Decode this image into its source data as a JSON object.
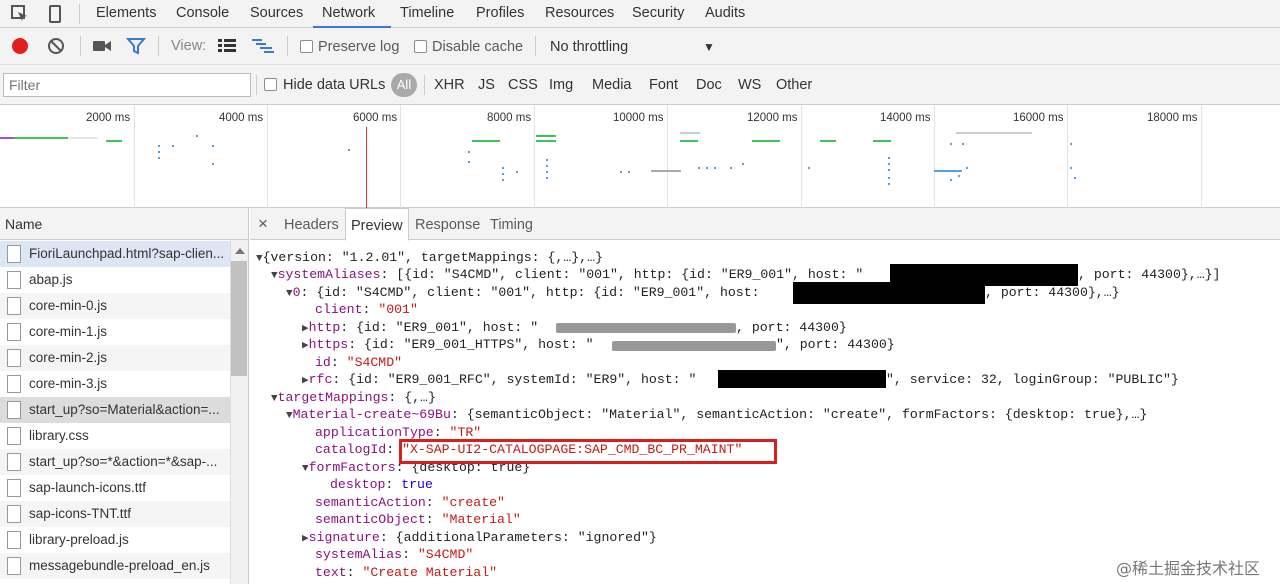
{
  "tabbar": {
    "tabs": [
      "Elements",
      "Console",
      "Sources",
      "Network",
      "Timeline",
      "Profiles",
      "Resources",
      "Security",
      "Audits"
    ],
    "active": "Network"
  },
  "toolbar": {
    "view_label": "View:",
    "preserve_log": "Preserve log",
    "disable_cache": "Disable cache",
    "throttling": "No throttling",
    "throttling_arrow": "▼"
  },
  "filterbar": {
    "filter_placeholder": "Filter",
    "hide_data_urls": "Hide data URLs",
    "types": [
      "All",
      "XHR",
      "JS",
      "CSS",
      "Img",
      "Media",
      "Font",
      "Doc",
      "WS",
      "Other"
    ]
  },
  "overview": {
    "ticks": [
      "2000 ms",
      "4000 ms",
      "6000 ms",
      "8000 ms",
      "10000 ms",
      "12000 ms",
      "14000 ms",
      "16000 ms",
      "18000 ms"
    ]
  },
  "requests": {
    "header": "Name",
    "files": [
      "FioriLaunchpad.html?sap-clien...",
      "abap.js",
      "core-min-0.js",
      "core-min-1.js",
      "core-min-2.js",
      "core-min-3.js",
      "start_up?so=Material&action=...",
      "library.css",
      "start_up?so=*&action=*&sap-...",
      "sap-launch-icons.ttf",
      "sap-icons-TNT.ttf",
      "library-preload.js",
      "messagebundle-preload_en.js"
    ]
  },
  "detail": {
    "close": "×",
    "tabs": [
      "Headers",
      "Preview",
      "Response",
      "Timing"
    ],
    "active": "Preview"
  },
  "preview": {
    "l1_a": "{version: \"1.2.01\", targetMappings: {,…},…}",
    "l2_key": "systemAliases",
    "l2_a": ": [{id: \"S4CMD\", client: \"001\", http: {id: \"ER9_001\", host: \"",
    "l2_b": ", port: 44300},…}]",
    "l3_key": "0",
    "l3_a": ": {id: \"S4CMD\", client: \"001\", http: {id: \"ER9_001\", host: ",
    "l3_b": ", port: 44300},…}",
    "client_key": "client",
    "client_val": "\"001\"",
    "http_key": "http",
    "http_a": ": {id: \"ER9_001\", host: \"",
    "http_b": ", port: 44300}",
    "https_key": "https",
    "https_a": ": {id: \"ER9_001_HTTPS\", host: \"",
    "https_b": "\", port: 44300}",
    "id_key": "id",
    "id_val": "\"S4CMD\"",
    "rfc_key": "rfc",
    "rfc_a": ": {id: \"ER9_001_RFC\", systemId: \"ER9\", host: \"",
    "rfc_b": "\", service: 32, loginGroup: \"PUBLIC\"}",
    "tm_key": "targetMappings",
    "tm_val": ": {,…}",
    "mc_key": "Material-create~69Bu",
    "mc_val": ": {semanticObject: \"Material\", semanticAction: \"create\", formFactors: {desktop: true},…}",
    "apptype_key": "applicationType",
    "apptype_val": "\"TR\"",
    "catalog_key": "catalogId",
    "catalog_val": "\"X-SAP-UI2-CATALOGPAGE:SAP_CMD_BC_PR_MAINT\"",
    "ff_key": "formFactors",
    "ff_val": ": {desktop: true}",
    "desktop_key": "desktop",
    "desktop_val": "true",
    "sa_key": "semanticAction",
    "sa_val": "\"create\"",
    "so_key": "semanticObject",
    "so_val": "\"Material\"",
    "sig_key": "signature",
    "sig_val": ": {additionalParameters: \"ignored\"}",
    "alias_key": "systemAlias",
    "alias_val": "\"S4CMD\"",
    "text_key": "text",
    "text_val": "\"Create Material\""
  },
  "watermark": "@稀土掘金技术社区",
  "colors": {
    "accent": "#3879d9",
    "record": "#e0201f",
    "key": "#881280",
    "string": "#c41a16",
    "highlight_border": "#d81e1e"
  }
}
